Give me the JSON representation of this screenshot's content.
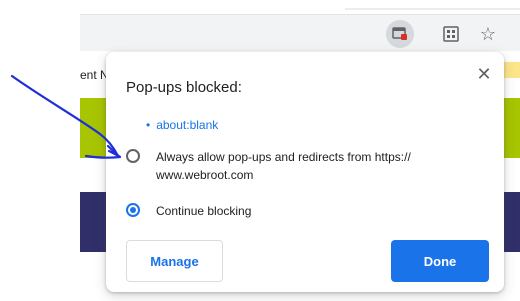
{
  "page_fragments": {
    "left_text": "ent N"
  },
  "toolbar": {
    "popup_icon": "popup-blocked-icon",
    "extension_icon": "extension-icon",
    "bookmark_icon": "star-icon"
  },
  "dialog": {
    "title": "Pop-ups blocked:",
    "close_icon": "close-icon",
    "blocked_url": "about:blank",
    "allow_label": "Always allow pop-ups and redirects from https:// www.webroot.com",
    "block_label": "Continue blocking",
    "manage_label": "Manage",
    "done_label": "Done"
  },
  "colors": {
    "accent": "#1a73e8",
    "annotation": "#1f2fd8",
    "green": "#a7c500",
    "purple": "#302f6a"
  }
}
